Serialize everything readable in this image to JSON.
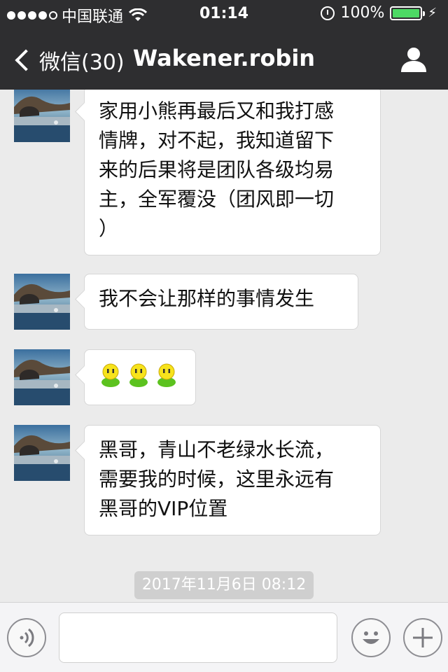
{
  "status_bar": {
    "carrier": "中国联通",
    "time": "01:14",
    "battery": "100%",
    "signal_dots": [
      true,
      true,
      true,
      true,
      false
    ],
    "battery_level": 1.0
  },
  "nav": {
    "back_label": "微信(30)",
    "title": "Wakener.robin"
  },
  "messages": [
    {
      "text": "家用小熊再最后又和我打感\n情牌，对不起，我知道留下\n来的后果将是团队各级均易\n主，全军覆没（团风即一切\n）"
    },
    {
      "text": "我不会让那样的事情发生"
    },
    {
      "emojis": [
        "face-emoji",
        "face-emoji",
        "face-emoji"
      ]
    },
    {
      "text": "黑哥，青山不老绿水长流，\n需要我的时候，这里永远有\n黑哥的VIP位置"
    }
  ],
  "timestamp": "2017年11月6日 08:12",
  "colors": {
    "bar": "#2e2e30",
    "chat_bg": "#ebebeb",
    "battery": "#4cd964",
    "emoji_body": "#5cc21f",
    "emoji_face": "#f7e31c"
  }
}
